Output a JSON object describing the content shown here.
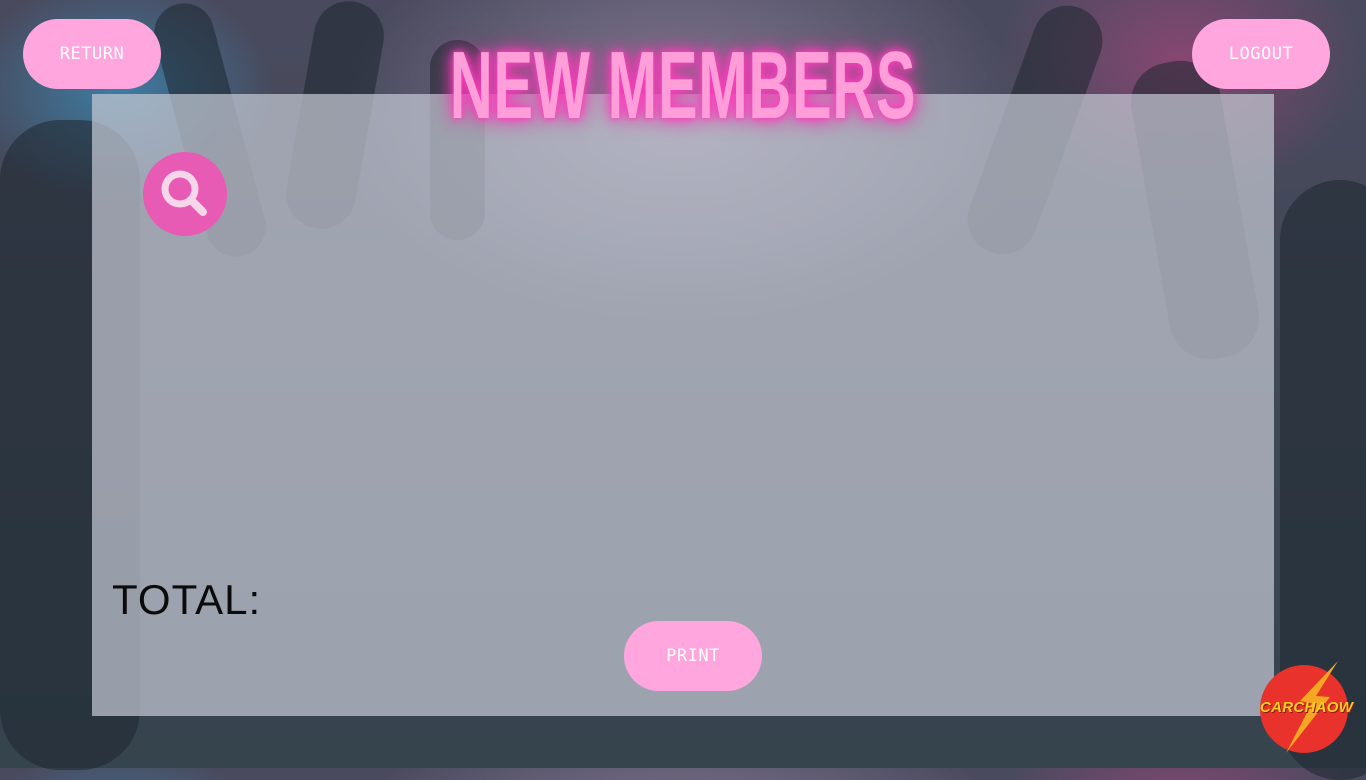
{
  "header": {
    "title": "NEW MEMBERS",
    "return_label": "RETURN",
    "logout_label": "LOGOUT"
  },
  "panel": {
    "search_icon": "search-icon",
    "total_label": "TOTAL:",
    "print_label": "PRINT"
  },
  "brand": {
    "logo_text": "CARCHAOW"
  },
  "colors": {
    "button_pink": "#ffa6de",
    "accent_pink": "#e85bb4",
    "title_glow": "#ff3fbf",
    "panel": "#c4c8d2"
  }
}
